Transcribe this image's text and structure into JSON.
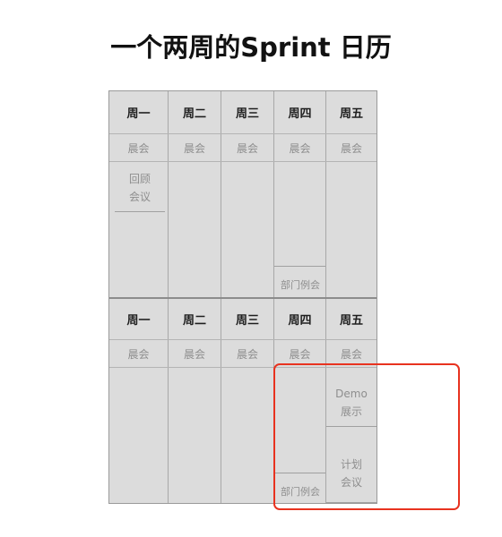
{
  "title": "一个两周的Sprint 日历",
  "weeks": [
    {
      "days": [
        "周一",
        "周二",
        "周三",
        "周四",
        "周五"
      ],
      "standups": [
        "晨会",
        "晨会",
        "晨会",
        "晨会",
        "晨会"
      ],
      "events": {
        "retro": [
          "回顾",
          "会议"
        ],
        "dept": "部门例会"
      }
    },
    {
      "days": [
        "周一",
        "周二",
        "周三",
        "周四",
        "周五"
      ],
      "standups": [
        "晨会",
        "晨会",
        "晨会",
        "晨会",
        "晨会"
      ],
      "events": {
        "dept": "部门例会",
        "demo": [
          "Demo",
          "展示"
        ],
        "planning": [
          "计划",
          "会议"
        ]
      }
    }
  ],
  "colors": {
    "highlight": "#e8321f",
    "grid_fill": "#dcdcdc",
    "muted_text": "#8e8e8e"
  }
}
